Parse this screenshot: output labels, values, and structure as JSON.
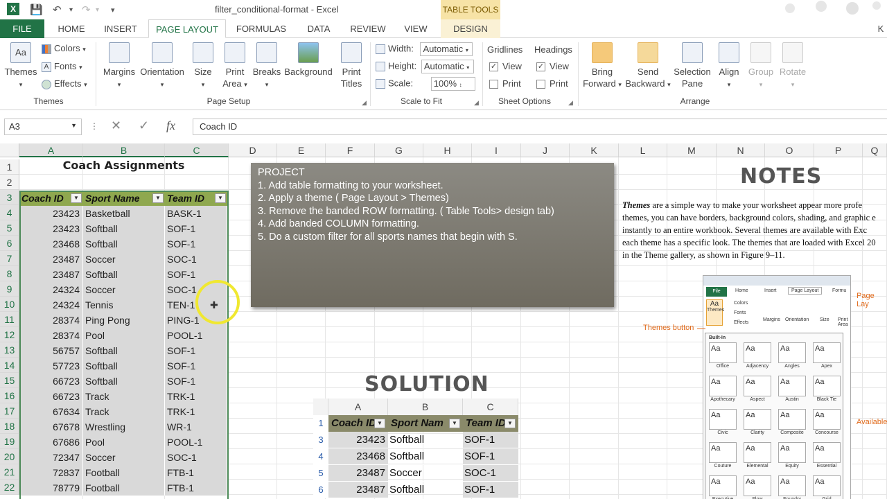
{
  "titlebar": {
    "title": "filter_conditional-format - Excel",
    "table_tools": "TABLE TOOLS",
    "user": "K"
  },
  "tabs": [
    "FILE",
    "HOME",
    "INSERT",
    "PAGE LAYOUT",
    "FORMULAS",
    "DATA",
    "REVIEW",
    "VIEW",
    "DESIGN"
  ],
  "ribbon": {
    "themes": {
      "themes": "Themes",
      "colors": "Colors",
      "fonts": "Fonts",
      "effects": "Effects",
      "group": "Themes"
    },
    "page_setup": {
      "margins": "Margins",
      "orientation": "Orientation",
      "size": "Size",
      "print_area_1": "Print",
      "print_area_2": "Area",
      "breaks": "Breaks",
      "background": "Background",
      "print_titles_1": "Print",
      "print_titles_2": "Titles",
      "group": "Page Setup"
    },
    "scale": {
      "width_label": "Width:",
      "width_value": "Automatic",
      "height_label": "Height:",
      "height_value": "Automatic",
      "scale_label": "Scale:",
      "scale_value": "100%",
      "group": "Scale to Fit"
    },
    "sheet_options": {
      "gridlines": "Gridlines",
      "headings": "Headings",
      "view": "View",
      "print": "Print",
      "group": "Sheet Options"
    },
    "arrange": {
      "bring_1": "Bring",
      "bring_2": "Forward",
      "send_1": "Send",
      "send_2": "Backward",
      "selection_1": "Selection",
      "selection_2": "Pane",
      "align": "Align",
      "group_btn": "Group",
      "rotate": "Rotate",
      "group": "Arrange"
    }
  },
  "formula_bar": {
    "name_box": "A3",
    "fx": "fx",
    "formula": "Coach ID"
  },
  "columns": [
    "A",
    "B",
    "C",
    "D",
    "E",
    "F",
    "G",
    "H",
    "I",
    "J",
    "K",
    "L",
    "M",
    "N",
    "O",
    "P",
    "Q"
  ],
  "rows": [
    "1",
    "2",
    "3",
    "4",
    "5",
    "6",
    "7",
    "8",
    "9",
    "10",
    "11",
    "12",
    "13",
    "14",
    "15",
    "16",
    "17",
    "18",
    "19",
    "20",
    "21",
    "22"
  ],
  "sheet": {
    "title": "Coach Assignments",
    "headers": [
      "Coach ID",
      "Sport Name",
      "Team ID"
    ],
    "data": [
      [
        "23423",
        "Basketball",
        "BASK-1"
      ],
      [
        "23423",
        "Softball",
        "SOF-1"
      ],
      [
        "23468",
        "Softball",
        "SOF-1"
      ],
      [
        "23487",
        "Soccer",
        "SOC-1"
      ],
      [
        "23487",
        "Softball",
        "SOF-1"
      ],
      [
        "24324",
        "Soccer",
        "SOC-1"
      ],
      [
        "24324",
        "Tennis",
        "TEN-1"
      ],
      [
        "28374",
        "Ping Pong",
        "PING-1"
      ],
      [
        "28374",
        "Pool",
        "POOL-1"
      ],
      [
        "56757",
        "Softball",
        "SOF-1"
      ],
      [
        "57723",
        "Softball",
        "SOF-1"
      ],
      [
        "66723",
        "Softball",
        "SOF-1"
      ],
      [
        "66723",
        "Track",
        "TRK-1"
      ],
      [
        "67634",
        "Track",
        "TRK-1"
      ],
      [
        "67678",
        "Wrestling",
        "WR-1"
      ],
      [
        "67686",
        "Pool",
        "POOL-1"
      ],
      [
        "72347",
        "Soccer",
        "SOC-1"
      ],
      [
        "72837",
        "Football",
        "FTB-1"
      ],
      [
        "78779",
        "Football",
        "FTB-1"
      ]
    ]
  },
  "project": {
    "title": "PROJECT",
    "items": [
      "1. Add table formatting to your worksheet.",
      "2. Apply a theme ( Page Layout > Themes)",
      "3. Remove the banded ROW formatting. ( Table Tools> design tab)",
      "4. Add banded COLUMN formatting.",
      "5.  Do a custom filter for all sports names that begin with S."
    ]
  },
  "notes": {
    "title": "NOTES",
    "lines": [
      "Themes are a simple way to make your worksheet appear more profe",
      "themes, you can have borders, background colors, shading, and graphic e",
      "instantly to an entire workbook. Several themes are available with Exc",
      "each theme has a specific look. The themes that are loaded with Excel 20",
      "in the Theme gallery, as shown in Figure 9–11."
    ]
  },
  "inset": {
    "tabs": [
      "File",
      "Home",
      "Insert",
      "Page Layout",
      "Formu"
    ],
    "themes_btn": "Themes",
    "colors": "Colors",
    "fonts": "Fonts",
    "effects": "Effects",
    "margins": "Margins",
    "orientation": "Orientation",
    "size": "Size",
    "print_area": "Print Area",
    "builtin": "Built-In",
    "theme_names": [
      "Office",
      "Adjacency",
      "Angles",
      "Apex",
      "Apothecary",
      "Aspect",
      "Austin",
      "Black Tie",
      "Civic",
      "Clarity",
      "Composite",
      "Concourse",
      "Couture",
      "Elemental",
      "Equity",
      "Essential",
      "Executive",
      "Flow",
      "Foundry",
      "Grid"
    ],
    "callout_themes": "Themes button",
    "callout_page": "Page Lay",
    "callout_available": "Available"
  },
  "solution": {
    "title": "SOLUTION",
    "columns": [
      "A",
      "B",
      "C"
    ],
    "row_numbers": [
      "1",
      "3",
      "4",
      "5",
      "6"
    ],
    "headers": [
      "Coach ID",
      "Sport Nam",
      "Team ID"
    ],
    "data": [
      [
        "23423",
        "Softball",
        "SOF-1"
      ],
      [
        "23468",
        "Softball",
        "SOF-1"
      ],
      [
        "23487",
        "Soccer",
        "SOC-1"
      ],
      [
        "23487",
        "Softball",
        "SOF-1"
      ]
    ]
  },
  "colors": {
    "excel_green": "#217346",
    "table_header": "#8fa84f",
    "table_row": "#d9d9d9",
    "project_box": "#7d7a70",
    "table_tools": "#f7e3a6"
  }
}
